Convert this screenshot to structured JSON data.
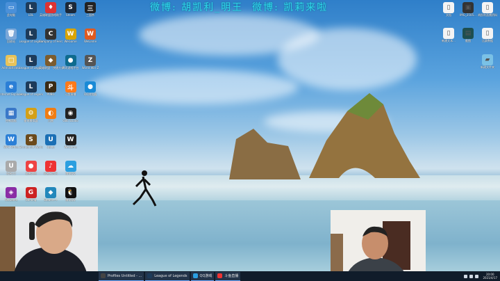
{
  "overlay_text": "微博: 胡凯利_明王  微博: 凯莉来啦",
  "desktop_icons_left": [
    {
      "label": "此电脑",
      "color": "#4a90d9",
      "glyph": "▭"
    },
    {
      "label": "LOL",
      "color": "#1d3b5a",
      "glyph": "L"
    },
    {
      "label": "英雄联盟游戏助手",
      "color": "#d33",
      "glyph": "♦"
    },
    {
      "label": "Steam",
      "color": "#1b2838",
      "glyph": "S"
    },
    {
      "label": "三国杀",
      "color": "#222",
      "glyph": "三"
    },
    {
      "label": "回收站",
      "color": "#7aa7d8",
      "glyph": "🗑"
    },
    {
      "label": "League of Legends",
      "color": "#1d3b5a",
      "glyph": "L"
    },
    {
      "label": "Company of Heroes 2",
      "color": "#333",
      "glyph": "C"
    },
    {
      "label": "WeGame",
      "color": "#d9a400",
      "glyph": "W"
    },
    {
      "label": "WeGame",
      "color": "#e05a20",
      "glyph": "W"
    },
    {
      "label": "Administrator",
      "color": "#e8c35a",
      "glyph": "□"
    },
    {
      "label": "League of Legends",
      "color": "#1d3b5a",
      "glyph": "L"
    },
    {
      "label": "英雄联盟 - 快捷方式",
      "color": "#7c5c2e",
      "glyph": "◆"
    },
    {
      "label": "腾讯游戏平台",
      "color": "#0e6b8f",
      "glyph": "●"
    },
    {
      "label": "World War Z",
      "color": "#555",
      "glyph": "Z"
    },
    {
      "label": "Internet Explorer",
      "color": "#2b7fd6",
      "glyph": "e"
    },
    {
      "label": "League of Legends",
      "color": "#1d3b5a",
      "glyph": "L"
    },
    {
      "label": "PUBG",
      "color": "#3a2a14",
      "glyph": "P"
    },
    {
      "label": "斗鱼直播",
      "color": "#ff7a1a",
      "glyph": "斗"
    },
    {
      "label": "QQ浏览器",
      "color": "#1a8ad6",
      "glyph": "●"
    },
    {
      "label": "控制面板",
      "color": "#3a78c8",
      "glyph": "▦"
    },
    {
      "label": "雷电模拟器",
      "color": "#d4a017",
      "glyph": "⚙"
    },
    {
      "label": "迅雷",
      "color": "#f07d14",
      "glyph": "◐"
    },
    {
      "label": "OBS Studio",
      "color": "#222",
      "glyph": "◉"
    },
    {
      "label": "WPS Office",
      "color": "#2b7fd6",
      "glyph": "W"
    },
    {
      "label": "Stronghold Warlords",
      "color": "#6b4a1c",
      "glyph": "S"
    },
    {
      "label": "Uplay",
      "color": "#1a6fb5",
      "glyph": "U"
    },
    {
      "label": "WeGame",
      "color": "#222",
      "glyph": "W"
    },
    {
      "label": "网易UU",
      "color": "#aaa",
      "glyph": "U"
    },
    {
      "label": "高德地图",
      "color": "#e44",
      "glyph": "●"
    },
    {
      "label": "网易云音乐",
      "color": "#e33",
      "glyph": "♪"
    },
    {
      "label": "腾讯QQ",
      "color": "#2b9fe0",
      "glyph": "☁"
    },
    {
      "label": "WeGame",
      "color": "#8a2da5",
      "glyph": "◈"
    },
    {
      "label": "Gaming",
      "color": "#c22",
      "glyph": "G"
    },
    {
      "label": "Steam++",
      "color": "#28b",
      "glyph": "◆"
    },
    {
      "label": "腾讯QQ",
      "color": "#111",
      "glyph": "🐧"
    }
  ],
  "desktop_icons_right": [
    {
      "label": "文档",
      "color": "#f4f4f4",
      "glyph": "▯"
    },
    {
      "label": "IMG_2505...",
      "color": "#333",
      "glyph": "▣"
    },
    {
      "label": "胡凯利直播资料",
      "color": "#f4f4f4",
      "glyph": "▯"
    },
    {
      "label": "新建文本...",
      "color": "#f4f4f4",
      "glyph": "▯"
    },
    {
      "label": "截图",
      "color": "#1e4e4f",
      "glyph": "▤"
    },
    {
      "label": "比赛数据",
      "color": "#f4f4f4",
      "glyph": "▯"
    },
    {
      "label": "新建文件夹",
      "color": "#7ac1e6",
      "glyph": "▰"
    }
  ],
  "taskbar": {
    "apps": [
      {
        "label": "Profiles Untitled - ...",
        "color": "#444"
      },
      {
        "label": "League of Legends",
        "color": "#1d3b5a"
      },
      {
        "label": "QQ游戏",
        "color": "#2b9fe0"
      },
      {
        "label": "斗鱼直播",
        "color": "#e33"
      }
    ],
    "time": "20:00",
    "date": "2021/4/17"
  }
}
